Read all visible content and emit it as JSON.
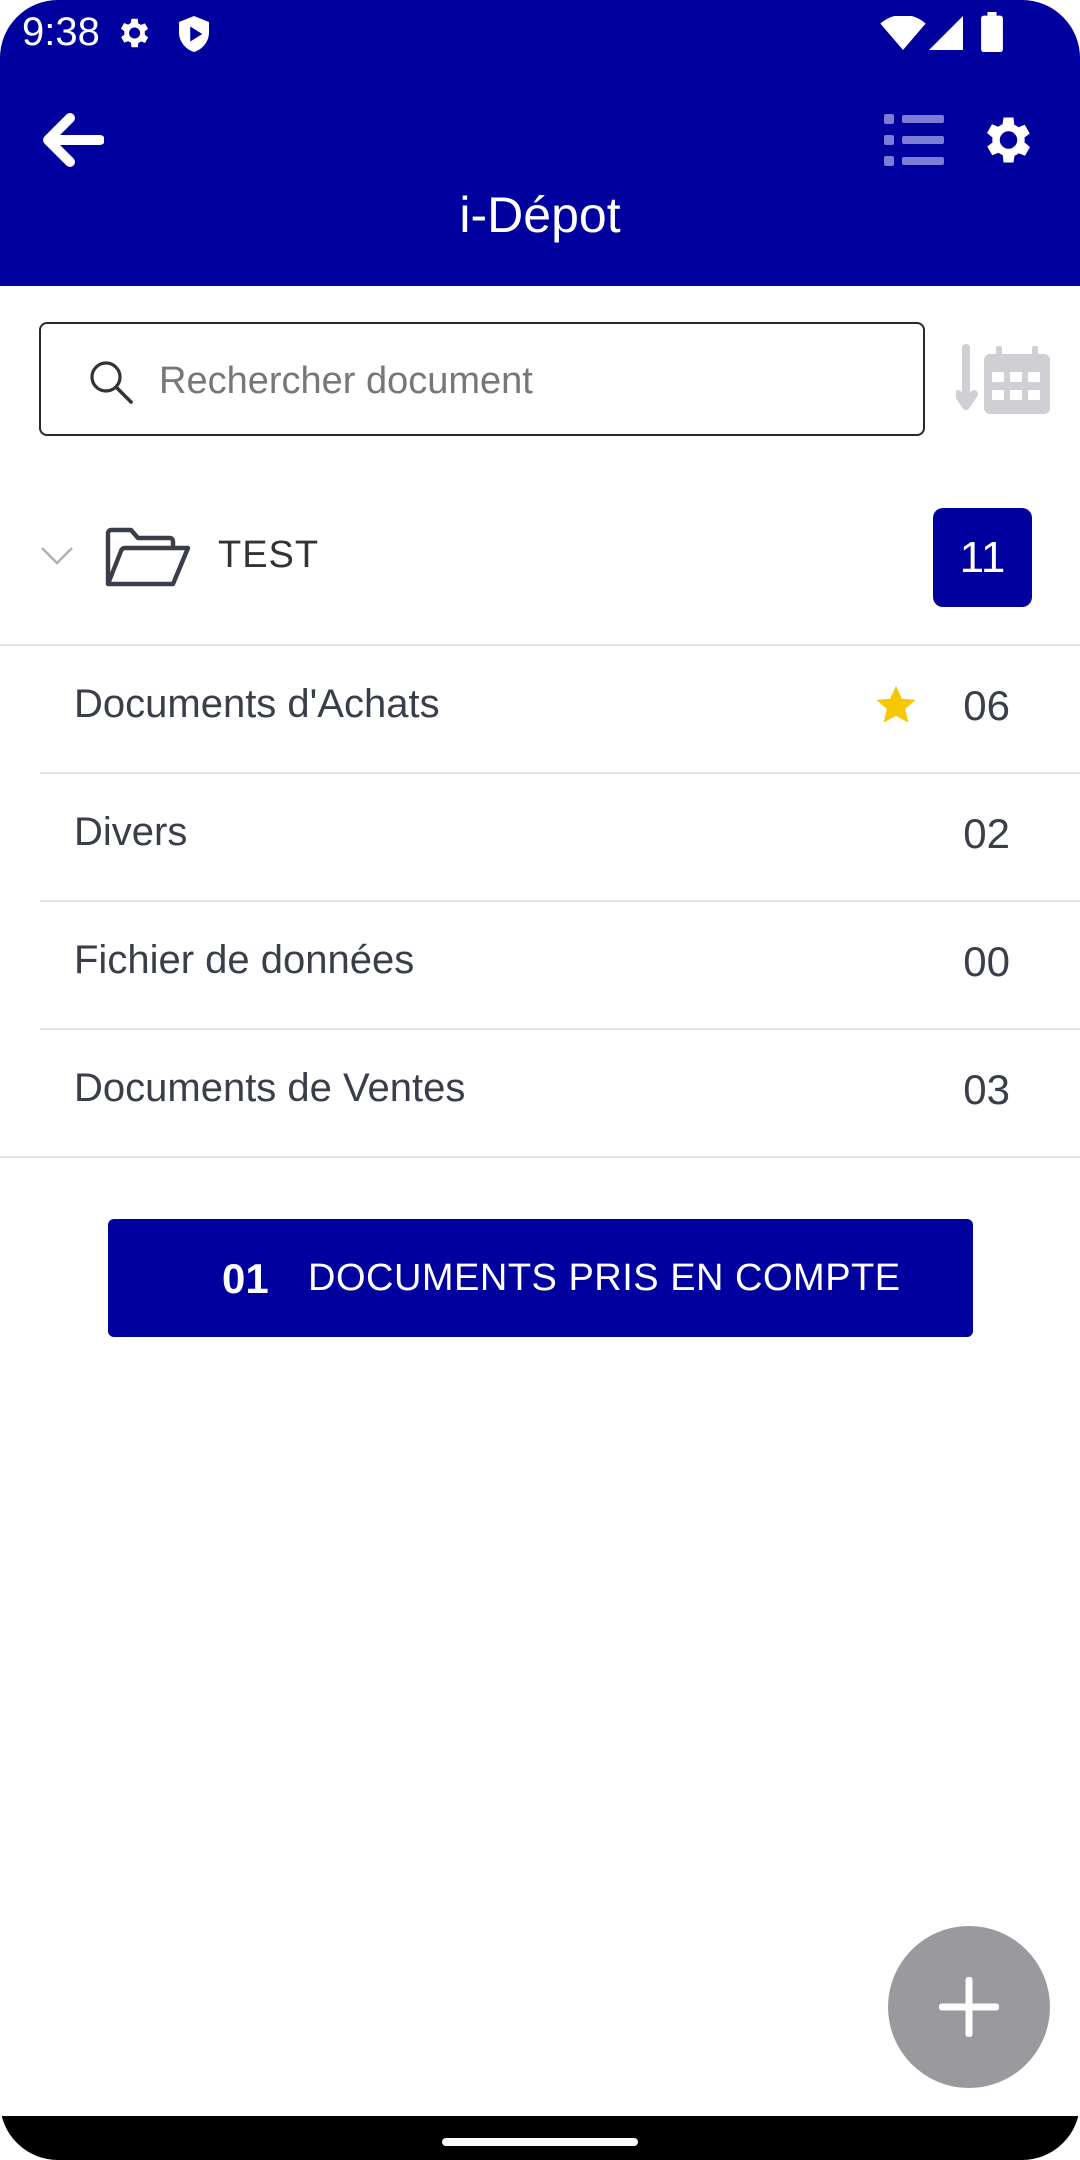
{
  "status_bar": {
    "time": "9:38"
  },
  "app_bar": {
    "title": "i-Dépot"
  },
  "search": {
    "placeholder": "Rechercher document"
  },
  "folder": {
    "name": "TEST",
    "count": "11"
  },
  "categories": [
    {
      "label": "Documents d'Achats",
      "count": "06",
      "starred": true
    },
    {
      "label": "Divers",
      "count": "02"
    },
    {
      "label": "Fichier de données",
      "count": "00"
    },
    {
      "label": "Documents de Ventes",
      "count": "03"
    }
  ],
  "action_button": {
    "count": "01",
    "label": "DOCUMENTS PRIS EN COMPTE"
  },
  "colors": {
    "primary": "#00009e",
    "star": "#f5c800",
    "fab": "#9a9a9e"
  },
  "icons": [
    "back-arrow-icon",
    "list-icon",
    "gear-icon",
    "search-icon",
    "sort-calendar-icon",
    "chevron-down-icon",
    "folder-open-icon",
    "star-icon",
    "plus-icon"
  ]
}
